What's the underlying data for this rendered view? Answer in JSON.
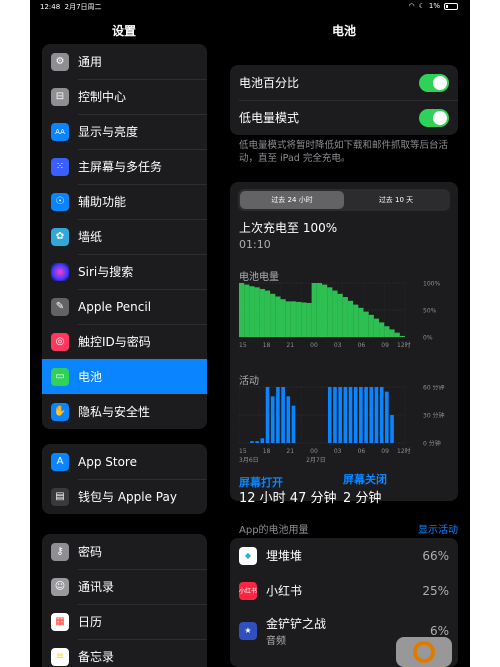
{
  "status": {
    "time": "12:48",
    "date": "2月7日周二",
    "battery": "1%"
  },
  "sidebar": {
    "title": "设置",
    "groups": [
      [
        {
          "label": "通用",
          "icon": "gear-icon",
          "color": "#8e8e93",
          "glyph": "⚙"
        },
        {
          "label": "控制中心",
          "icon": "switches-icon",
          "color": "#8e8e93",
          "glyph": "⊟"
        },
        {
          "label": "显示与亮度",
          "icon": "brightness-icon",
          "color": "#0a84ff",
          "glyph": "AA"
        },
        {
          "label": "主屏幕与多任务",
          "icon": "home-grid-icon",
          "color": "#3a5fff",
          "glyph": "⁙"
        },
        {
          "label": "辅助功能",
          "icon": "accessibility-icon",
          "color": "#0a84ff",
          "glyph": "☉"
        },
        {
          "label": "墙纸",
          "icon": "wallpaper-icon",
          "color": "#30a8d8",
          "glyph": "✿"
        },
        {
          "label": "Siri与搜索",
          "icon": "siri-icon",
          "color": "#2b2b6e",
          "glyph": "◉"
        },
        {
          "label": "Apple Pencil",
          "icon": "pencil-icon",
          "color": "#636366",
          "glyph": "✎"
        },
        {
          "label": "触控ID与密码",
          "icon": "fingerprint-icon",
          "color": "#ff375f",
          "glyph": "◎"
        },
        {
          "label": "电池",
          "icon": "battery-icon",
          "color": "#30d158",
          "glyph": "▭"
        },
        {
          "label": "隐私与安全性",
          "icon": "hand-icon",
          "color": "#0a84ff",
          "glyph": "✋"
        }
      ],
      [
        {
          "label": "App Store",
          "icon": "app-store-icon",
          "color": "#0a84ff",
          "glyph": "A"
        },
        {
          "label": "钱包与 Apple Pay",
          "icon": "wallet-icon",
          "color": "#3a3a3c",
          "glyph": "▤"
        }
      ],
      [
        {
          "label": "密码",
          "icon": "key-icon",
          "color": "#8e8e93",
          "glyph": "⚷"
        },
        {
          "label": "通讯录",
          "icon": "contacts-icon",
          "color": "#9a9a9e",
          "glyph": "☺"
        },
        {
          "label": "日历",
          "icon": "calendar-icon",
          "color": "#ffffff",
          "glyph": "▦"
        },
        {
          "label": "备忘录",
          "icon": "notes-icon",
          "color": "#ffd60a",
          "glyph": "≡"
        }
      ]
    ]
  },
  "detail": {
    "title": "电池",
    "battery_percentage_label": "电池百分比",
    "low_power_label": "低电量模式",
    "low_power_note": "低电量模式将暂时降低如下载和邮件抓取等后台活动，直至 iPad 完全充电。",
    "segments": [
      "过去 24 小时",
      "过去 10 天"
    ],
    "last_charge_label": "上次充电至 100%",
    "last_charge_time": "01:10",
    "level_title": "电池电量",
    "activity_title": "活动",
    "screen_on_label": "屏幕打开",
    "screen_off_label": "屏幕关闭",
    "screen_on_time": "12 小时 47 分钟",
    "screen_off_time": "2 分钟",
    "usage_label": "App的电池用量",
    "show_activity": "显示活动",
    "apps": [
      {
        "name": "埋堆堆",
        "sub": "",
        "percent": "66%",
        "icon": "maiduidui-icon",
        "color": "#ffffff"
      },
      {
        "name": "小红书",
        "sub": "",
        "percent": "25%",
        "icon": "xiaohongshu-icon",
        "color": "#ff2442"
      },
      {
        "name": "金铲铲之战",
        "sub": "音频",
        "percent": "6%",
        "icon": "game-icon",
        "color": "#3050c0"
      }
    ]
  },
  "chart_data": [
    {
      "type": "area",
      "title": "电池电量",
      "x": [
        "15",
        "18",
        "21",
        "00",
        "03",
        "06",
        "09",
        "12时"
      ],
      "y_ticks": [
        "100%",
        "50%",
        "0%"
      ],
      "ylim": [
        0,
        100
      ],
      "values": [
        100,
        97,
        94,
        92,
        89,
        86,
        80,
        75,
        70,
        66,
        66,
        65,
        64,
        63,
        100,
        100,
        97,
        92,
        86,
        80,
        74,
        67,
        60,
        54,
        47,
        41,
        34,
        27,
        20,
        14,
        8,
        2
      ],
      "color": "#30d158"
    },
    {
      "type": "bar",
      "title": "活动",
      "x": [
        "15",
        "18",
        "21",
        "00",
        "03",
        "06",
        "09",
        "12时"
      ],
      "x_dates": [
        "3月6日",
        "2月7日"
      ],
      "y_ticks": [
        "60 分钟",
        "30 分钟",
        "0 分钟"
      ],
      "ylim": [
        0,
        60
      ],
      "values": [
        0,
        0,
        2,
        2,
        5,
        60,
        50,
        60,
        60,
        50,
        40,
        0,
        0,
        0,
        0,
        0,
        0,
        60,
        60,
        60,
        60,
        60,
        60,
        60,
        60,
        60,
        60,
        60,
        55,
        30,
        0,
        0
      ],
      "color": "#0a84ff"
    }
  ]
}
